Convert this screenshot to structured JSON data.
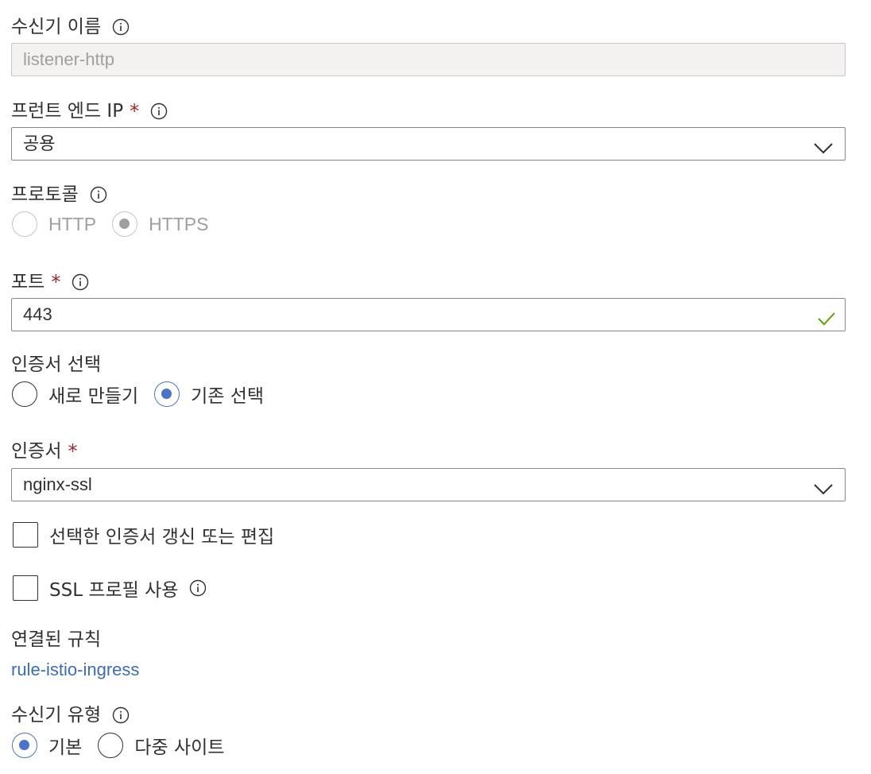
{
  "listener_name": {
    "label": "수신기 이름",
    "value": "listener-http"
  },
  "frontend_ip": {
    "label": "프런트 엔드 IP",
    "required": "*",
    "selected": "공용"
  },
  "protocol": {
    "label": "프로토콜",
    "options": [
      "HTTP",
      "HTTPS"
    ],
    "selected": "HTTPS"
  },
  "port": {
    "label": "포트",
    "required": "*",
    "value": "443"
  },
  "cert_choice": {
    "label": "인증서 선택",
    "options": [
      "새로 만들기",
      "기존 선택"
    ],
    "selected": "기존 선택"
  },
  "certificate": {
    "label": "인증서",
    "required": "*",
    "selected": "nginx-ssl"
  },
  "renew_cert": {
    "label": "선택한 인증서 갱신 또는 편집"
  },
  "ssl_profile": {
    "label": "SSL 프로필 사용"
  },
  "associated_rules": {
    "label": "연결된 규칙",
    "link": "rule-istio-ingress"
  },
  "listener_type": {
    "label": "수신기 유형",
    "options": [
      "기본",
      "다중 사이트"
    ],
    "selected": "기본"
  },
  "colors": {
    "accent": "#4a74c9",
    "required": "#a4262c",
    "link": "#3a6cc0",
    "valid_check": "#57a300"
  }
}
